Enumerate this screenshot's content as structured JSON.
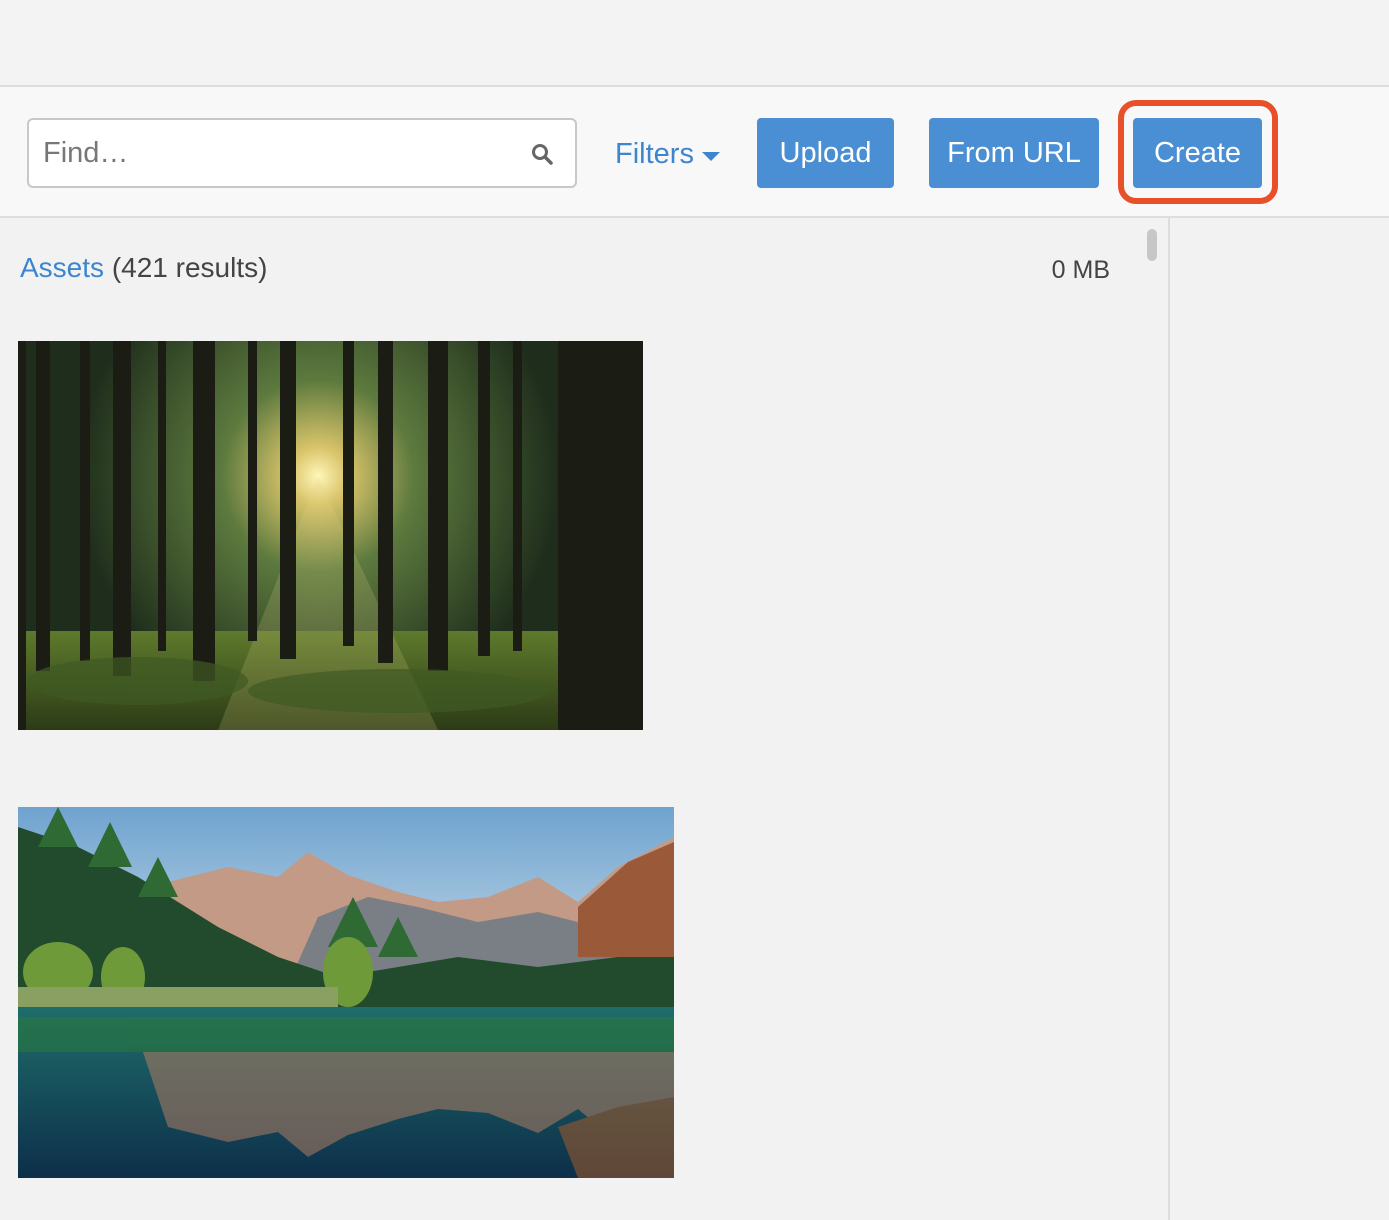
{
  "toolbar": {
    "search": {
      "placeholder": "Find…",
      "value": ""
    },
    "filters_label": "Filters",
    "upload_label": "Upload",
    "from_url_label": "From URL",
    "create_label": "Create"
  },
  "assets": {
    "link_label": "Assets",
    "count_text": "(421 results)",
    "total_size": "0 MB",
    "items": [
      {
        "kind": "forest-photo"
      },
      {
        "kind": "mountain-lake-photo"
      }
    ]
  },
  "colors": {
    "accent": "#4a8fd4",
    "link": "#3d86cf",
    "highlight": "#e8502a"
  }
}
